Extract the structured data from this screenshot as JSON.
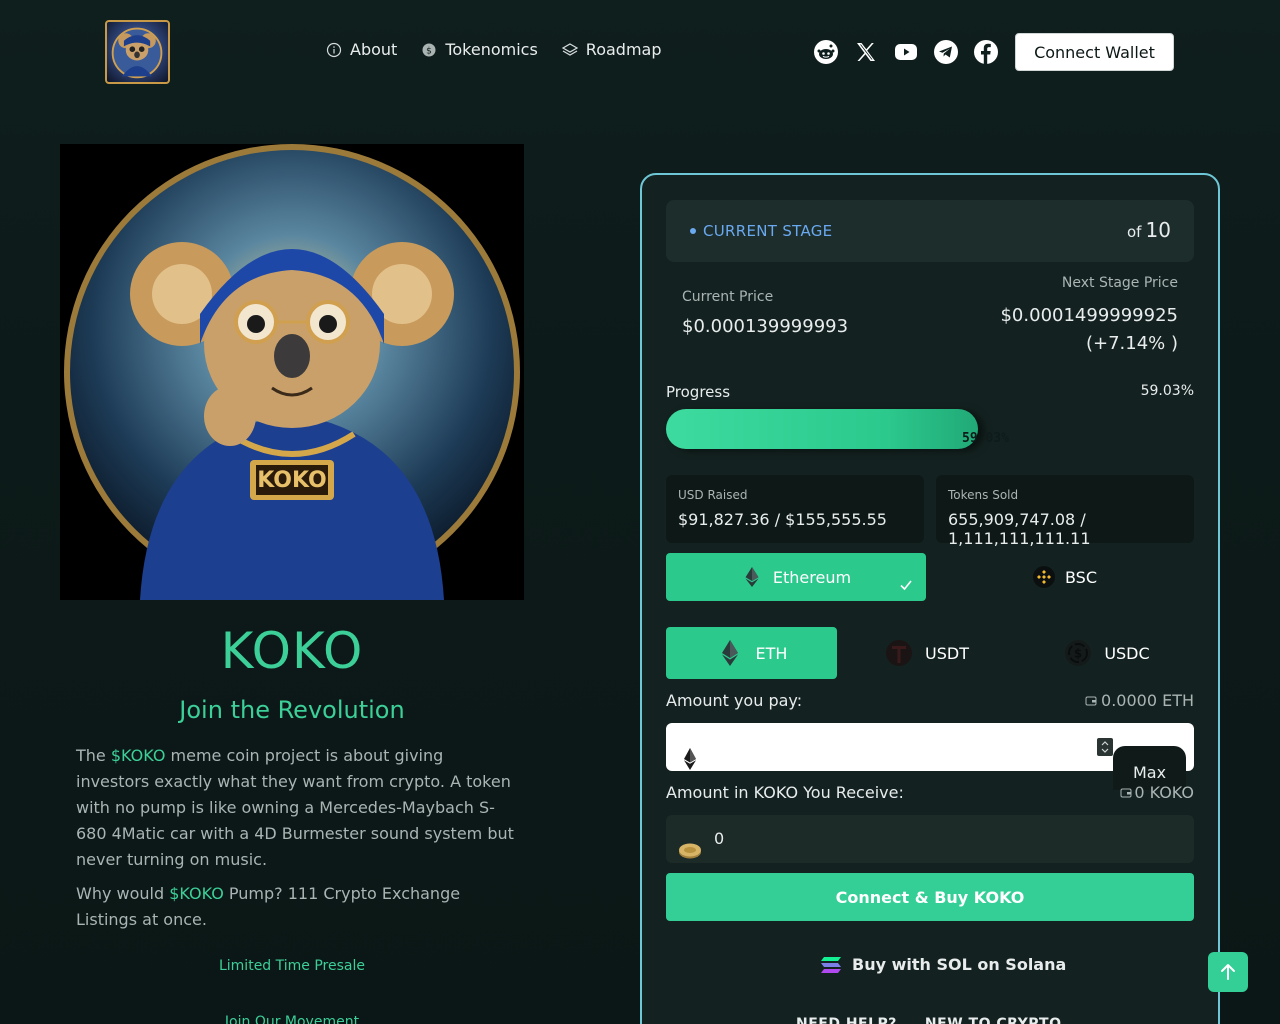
{
  "header": {
    "nav": [
      {
        "label": "About",
        "icon": "info-icon"
      },
      {
        "label": "Tokenomics",
        "icon": "dollar-coin-icon"
      },
      {
        "label": "Roadmap",
        "icon": "layers-icon"
      }
    ],
    "socials": [
      "reddit-icon",
      "x-icon",
      "youtube-icon",
      "telegram-icon",
      "facebook-icon"
    ],
    "connect_wallet": "Connect Wallet"
  },
  "hero": {
    "title": "KOKO",
    "subtitle": "Join the Revolution",
    "desc1_pre": "The ",
    "desc1_ticker": "$KOKO",
    "desc1_post": " meme coin project is about giving investors exactly what they want from crypto. A token with no pump is like owning a Mercedes-Maybach S-680 4Matic car with a 4D Burmester sound system but never turning on music.",
    "desc2_pre": "Why would ",
    "desc2_ticker": "$KOKO",
    "desc2_post": " Pump? 111 Crypto Exchange Listings at once.",
    "limited": "Limited Time Presale",
    "join": "Join Our Movement"
  },
  "widget": {
    "stage_label": "CURRENT STAGE",
    "stage_of": "of",
    "stage_total": "10",
    "current_price_label": "Current Price",
    "current_price": "$0.000139999993",
    "next_price_label": "Next Stage Price",
    "next_price": "$0.0001499999925 (+7.14% )",
    "progress_label": "Progress",
    "progress_pct_text": "59.03%",
    "progress_value": 59.03,
    "usd_raised_label": "USD Raised",
    "usd_raised": "$91,827.36 / $155,555.55",
    "tokens_sold_label": "Tokens Sold",
    "tokens_sold": "655,909,747.08 / 1,111,111,111.11",
    "networks": [
      {
        "label": "Ethereum",
        "selected": true
      },
      {
        "label": "BSC",
        "selected": false
      }
    ],
    "currencies": [
      {
        "label": "ETH",
        "selected": true
      },
      {
        "label": "USDT",
        "selected": false
      },
      {
        "label": "USDC",
        "selected": false
      }
    ],
    "pay_label": "Amount you pay:",
    "pay_balance": "0.0000 ETH",
    "pay_value": "",
    "max_label": "Max",
    "receive_label": "Amount in KOKO You Receive:",
    "receive_balance": "0 KOKO",
    "receive_value": "0",
    "buy_label": "Connect & Buy KOKO",
    "sol_label": "Buy with SOL on Solana",
    "help_left": "NEED HELP?",
    "help_right": "NEW TO CRYPTO"
  },
  "colors": {
    "accent": "#33cf97",
    "background": "#0f1f1d",
    "stage_blue": "#6aa9f0",
    "widget_border": "#6fc6d6"
  }
}
